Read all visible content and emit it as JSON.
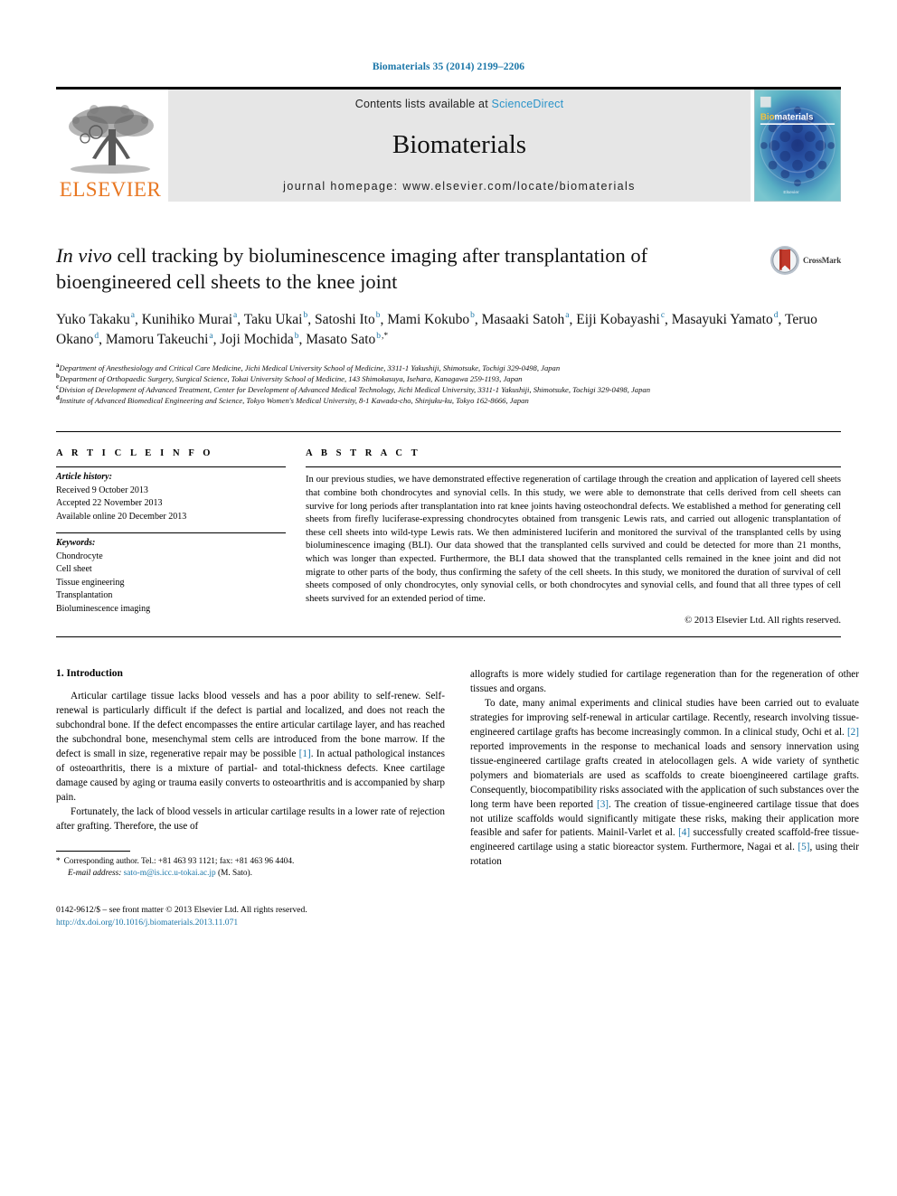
{
  "running_head": "Biomaterials 35 (2014) 2199–2206",
  "masthead": {
    "publisher_name": "ELSEVIER",
    "contents_prefix": "Contents lists available at ",
    "sciencedirect": "ScienceDirect",
    "journal_name": "Biomaterials",
    "homepage": "journal homepage: www.elsevier.com/locate/biomaterials",
    "cover_title_a": "Bio",
    "cover_title_b": "materials",
    "cover_footer": "Elsevier"
  },
  "crossmark": {
    "label": "CrossMark"
  },
  "title": {
    "italic_lead": "In vivo",
    "rest": " cell tracking by bioluminescence imaging after transplantation of bioengineered cell sheets to the knee joint"
  },
  "authors": [
    {
      "name": "Yuko Takaku",
      "sup": "a",
      "sep": ", "
    },
    {
      "name": "Kunihiko Murai",
      "sup": "a",
      "sep": ", "
    },
    {
      "name": "Taku Ukai",
      "sup": "b",
      "sep": ", "
    },
    {
      "name": "Satoshi Ito",
      "sup": "b",
      "sep": ", "
    },
    {
      "name": "Mami Kokubo",
      "sup": "b",
      "sep": ", "
    },
    {
      "name": "Masaaki Satoh",
      "sup": "a",
      "sep": ", "
    },
    {
      "name": "Eiji Kobayashi",
      "sup": "c",
      "sep": ", "
    },
    {
      "name": "Masayuki Yamato",
      "sup": "d",
      "sep": ", "
    },
    {
      "name": "Teruo Okano",
      "sup": "d",
      "sep": ", "
    },
    {
      "name": "Mamoru Takeuchi",
      "sup": "a",
      "sep": ", "
    },
    {
      "name": "Joji Mochida",
      "sup": "b",
      "sep": ", "
    },
    {
      "name": "Masato Sato",
      "sup": "b,*",
      "sep": ""
    }
  ],
  "affiliations": [
    {
      "marker": "a",
      "text": "Department of Anesthesiology and Critical Care Medicine, Jichi Medical University School of Medicine, 3311-1 Yakushiji, Shimotsuke, Tochigi 329-0498, Japan"
    },
    {
      "marker": "b",
      "text": "Department of Orthopaedic Surgery, Surgical Science, Tokai University School of Medicine, 143 Shimokasuya, Isehara, Kanagawa 259-1193, Japan"
    },
    {
      "marker": "c",
      "text": "Division of Development of Advanced Treatment, Center for Development of Advanced Medical Technology, Jichi Medical University, 3311-1 Yakushiji, Shimotsuke, Tochigi 329-0498, Japan"
    },
    {
      "marker": "d",
      "text": "Institute of Advanced Biomedical Engineering and Science, Tokyo Women's Medical University, 8-1 Kawada-cho, Shinjuku-ku, Tokyo 162-8666, Japan"
    }
  ],
  "article_info": {
    "heading": "A R T I C L E   I N F O",
    "history_label": "Article history:",
    "history": [
      "Received 9 October 2013",
      "Accepted 22 November 2013",
      "Available online 20 December 2013"
    ],
    "keywords_label": "Keywords:",
    "keywords": [
      "Chondrocyte",
      "Cell sheet",
      "Tissue engineering",
      "Transplantation",
      "Bioluminescence imaging"
    ]
  },
  "abstract": {
    "heading": "A B S T R A C T",
    "text": "In our previous studies, we have demonstrated effective regeneration of cartilage through the creation and application of layered cell sheets that combine both chondrocytes and synovial cells. In this study, we were able to demonstrate that cells derived from cell sheets can survive for long periods after transplantation into rat knee joints having osteochondral defects. We established a method for generating cell sheets from firefly luciferase-expressing chondrocytes obtained from transgenic Lewis rats, and carried out allogenic transplantation of these cell sheets into wild-type Lewis rats. We then administered luciferin and monitored the survival of the transplanted cells by using bioluminescence imaging (BLI). Our data showed that the transplanted cells survived and could be detected for more than 21 months, which was longer than expected. Furthermore, the BLI data showed that the transplanted cells remained in the knee joint and did not migrate to other parts of the body, thus confirming the safety of the cell sheets. In this study, we monitored the duration of survival of cell sheets composed of only chondrocytes, only synovial cells, or both chondrocytes and synovial cells, and found that all three types of cell sheets survived for an extended period of time.",
    "copyright": "© 2013 Elsevier Ltd. All rights reserved."
  },
  "introduction": {
    "heading": "1. Introduction",
    "left_paragraphs": [
      "Articular cartilage tissue lacks blood vessels and has a poor ability to self-renew. Self-renewal is particularly difficult if the defect is partial and localized, and does not reach the subchondral bone. If the defect encompasses the entire articular cartilage layer, and has reached the subchondral bone, mesenchymal stem cells are introduced from the bone marrow. If the defect is small in size, regenerative repair may be possible [1]. In actual pathological instances of osteoarthritis, there is a mixture of partial- and total-thickness defects. Knee cartilage damage caused by aging or trauma easily converts to osteoarthritis and is accompanied by sharp pain.",
      "Fortunately, the lack of blood vessels in articular cartilage results in a lower rate of rejection after grafting. Therefore, the use of"
    ],
    "right_paragraphs": [
      "allografts is more widely studied for cartilage regeneration than for the regeneration of other tissues and organs.",
      "To date, many animal experiments and clinical studies have been carried out to evaluate strategies for improving self-renewal in articular cartilage. Recently, research involving tissue-engineered cartilage grafts has become increasingly common. In a clinical study, Ochi et al. [2] reported improvements in the response to mechanical loads and sensory innervation using tissue-engineered cartilage grafts created in atelocollagen gels. A wide variety of synthetic polymers and biomaterials are used as scaffolds to create bioengineered cartilage grafts. Consequently, biocompatibility risks associated with the application of such substances over the long term have been reported [3]. The creation of tissue-engineered cartilage tissue that does not utilize scaffolds would significantly mitigate these risks, making their application more feasible and safer for patients. Mainil-Varlet et al. [4] successfully created scaffold-free tissue-engineered cartilage using a static bioreactor system. Furthermore, Nagai et al. [5], using their rotation"
    ]
  },
  "footnote": {
    "star": "*",
    "corresponding": "Corresponding author. Tel.: +81 463 93 1121; fax: +81 463 96 4404.",
    "email_label": "E-mail address:",
    "email": "sato-m@is.icc.u-tokai.ac.jp",
    "email_suffix": " (M. Sato)."
  },
  "imprint": {
    "line1": "0142-9612/$ – see front matter © 2013 Elsevier Ltd. All rights reserved.",
    "doi": "http://dx.doi.org/10.1016/j.biomaterials.2013.11.071"
  },
  "colors": {
    "link": "#1a76a8",
    "elsevier_orange": "#E87722",
    "sciencedirect": "#2a93c9",
    "banner_bg": "#e6e6e6"
  }
}
